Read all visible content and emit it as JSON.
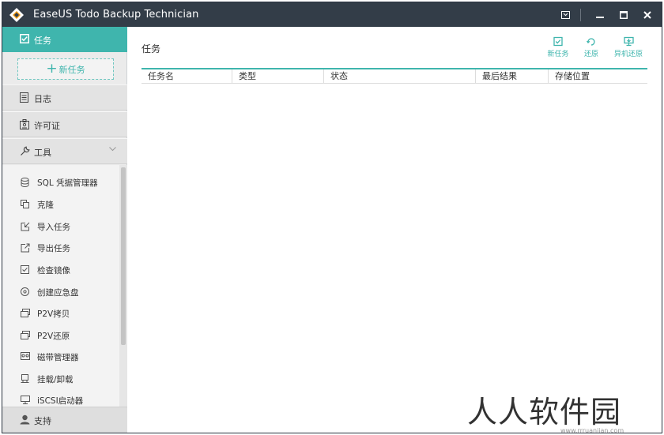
{
  "window": {
    "title": "EaseUS Todo Backup Technician",
    "controls": [
      "feedback-icon",
      "minimize-icon",
      "maximize-icon",
      "close-icon"
    ]
  },
  "colors": {
    "accent": "#3fb5ad",
    "titlebar": "#333d48",
    "sidebar": "#ebebeb"
  },
  "sidebar": {
    "task": {
      "label": "任务",
      "icon": "checkbox-icon"
    },
    "new_task": {
      "plus": "+",
      "label": "新任务"
    },
    "log": {
      "label": "日志",
      "icon": "log-icon"
    },
    "license": {
      "label": "许可证",
      "icon": "license-icon"
    },
    "tools": {
      "label": "工具",
      "icon": "wrench-icon"
    },
    "tool_items": [
      {
        "label": "SQL 凭据管理器",
        "icon": "database-icon"
      },
      {
        "label": "克隆",
        "icon": "clone-icon"
      },
      {
        "label": "导入任务",
        "icon": "import-icon"
      },
      {
        "label": "导出任务",
        "icon": "export-icon"
      },
      {
        "label": "检查镜像",
        "icon": "check-image-icon"
      },
      {
        "label": "创建应急盘",
        "icon": "emergency-disk-icon"
      },
      {
        "label": "P2V拷贝",
        "icon": "p2v-copy-icon"
      },
      {
        "label": "P2V还原",
        "icon": "p2v-restore-icon"
      },
      {
        "label": "磁带管理器",
        "icon": "tape-icon"
      },
      {
        "label": "挂载/卸载",
        "icon": "mount-icon"
      },
      {
        "label": "iSCSI启动器",
        "icon": "iscsi-icon"
      }
    ],
    "support": {
      "label": "支持",
      "icon": "user-support-icon"
    }
  },
  "main": {
    "title": "任务",
    "actions": [
      {
        "label": "新任务",
        "icon": "new-task-icon"
      },
      {
        "label": "还原",
        "icon": "restore-icon"
      },
      {
        "label": "异机还原",
        "icon": "remote-restore-icon"
      }
    ],
    "columns": [
      "任务名",
      "类型",
      "状态",
      "最后结果",
      "存储位置"
    ],
    "rows": []
  },
  "watermark": {
    "text": "人人软件园",
    "url": "www.rrruanjian.com"
  }
}
